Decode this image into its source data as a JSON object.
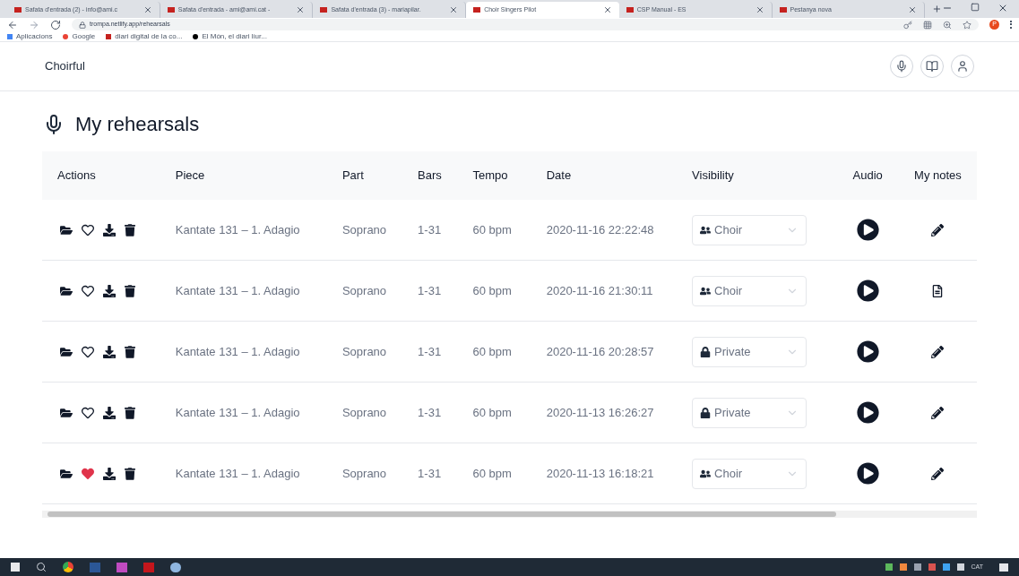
{
  "browser": {
    "tabs": [
      {
        "title": "Safata d'entrada (2) - info@ami.c",
        "selected": false
      },
      {
        "title": "Safata d'entrada - ami@ami.cat -",
        "selected": false
      },
      {
        "title": "Safata d'entrada (3) - mariapilar.",
        "selected": false
      },
      {
        "title": "Choir Singers Pilot",
        "selected": true
      },
      {
        "title": "CSP Manual - ES",
        "selected": false
      },
      {
        "title": "Pestanya nova",
        "selected": false
      }
    ],
    "url": "trompa.netlify.app/rehearsals",
    "profile": "P",
    "bookmarks": [
      "Aplicacions",
      "Google",
      "diari digital de la co...",
      "El Món, el diari líur..."
    ]
  },
  "app": {
    "brand": "Choirful",
    "title": "My rehearsals"
  },
  "table": {
    "columns": [
      "Actions",
      "Piece",
      "Part",
      "Bars",
      "Tempo",
      "Date",
      "Visibility",
      "Audio",
      "My notes"
    ],
    "rows": [
      {
        "liked": false,
        "piece": "Kantate 131 – 1. Adagio",
        "part": "Soprano",
        "bars": "1-31",
        "tempo": "60 bpm",
        "date": "2020-11-16 22:22:48",
        "visibility": {
          "kind": "choir",
          "label": "Choir"
        },
        "notes": {
          "kind": "edit"
        }
      },
      {
        "liked": false,
        "piece": "Kantate 131 – 1. Adagio",
        "part": "Soprano",
        "bars": "1-31",
        "tempo": "60 bpm",
        "date": "2020-11-16 21:30:11",
        "visibility": {
          "kind": "choir",
          "label": "Choir"
        },
        "notes": {
          "kind": "document"
        }
      },
      {
        "liked": false,
        "piece": "Kantate 131 – 1. Adagio",
        "part": "Soprano",
        "bars": "1-31",
        "tempo": "60 bpm",
        "date": "2020-11-16 20:28:57",
        "visibility": {
          "kind": "private",
          "label": "Private"
        },
        "notes": {
          "kind": "edit"
        }
      },
      {
        "liked": false,
        "piece": "Kantate 131 – 1. Adagio",
        "part": "Soprano",
        "bars": "1-31",
        "tempo": "60 bpm",
        "date": "2020-11-13 16:26:27",
        "visibility": {
          "kind": "private",
          "label": "Private"
        },
        "notes": {
          "kind": "edit"
        }
      },
      {
        "liked": true,
        "piece": "Kantate 131 – 1. Adagio",
        "part": "Soprano",
        "bars": "1-31",
        "tempo": "60 bpm",
        "date": "2020-11-13 16:18:21",
        "visibility": {
          "kind": "choir",
          "label": "Choir"
        },
        "notes": {
          "kind": "edit"
        }
      }
    ]
  },
  "taskbar": {
    "language": "CAT"
  }
}
